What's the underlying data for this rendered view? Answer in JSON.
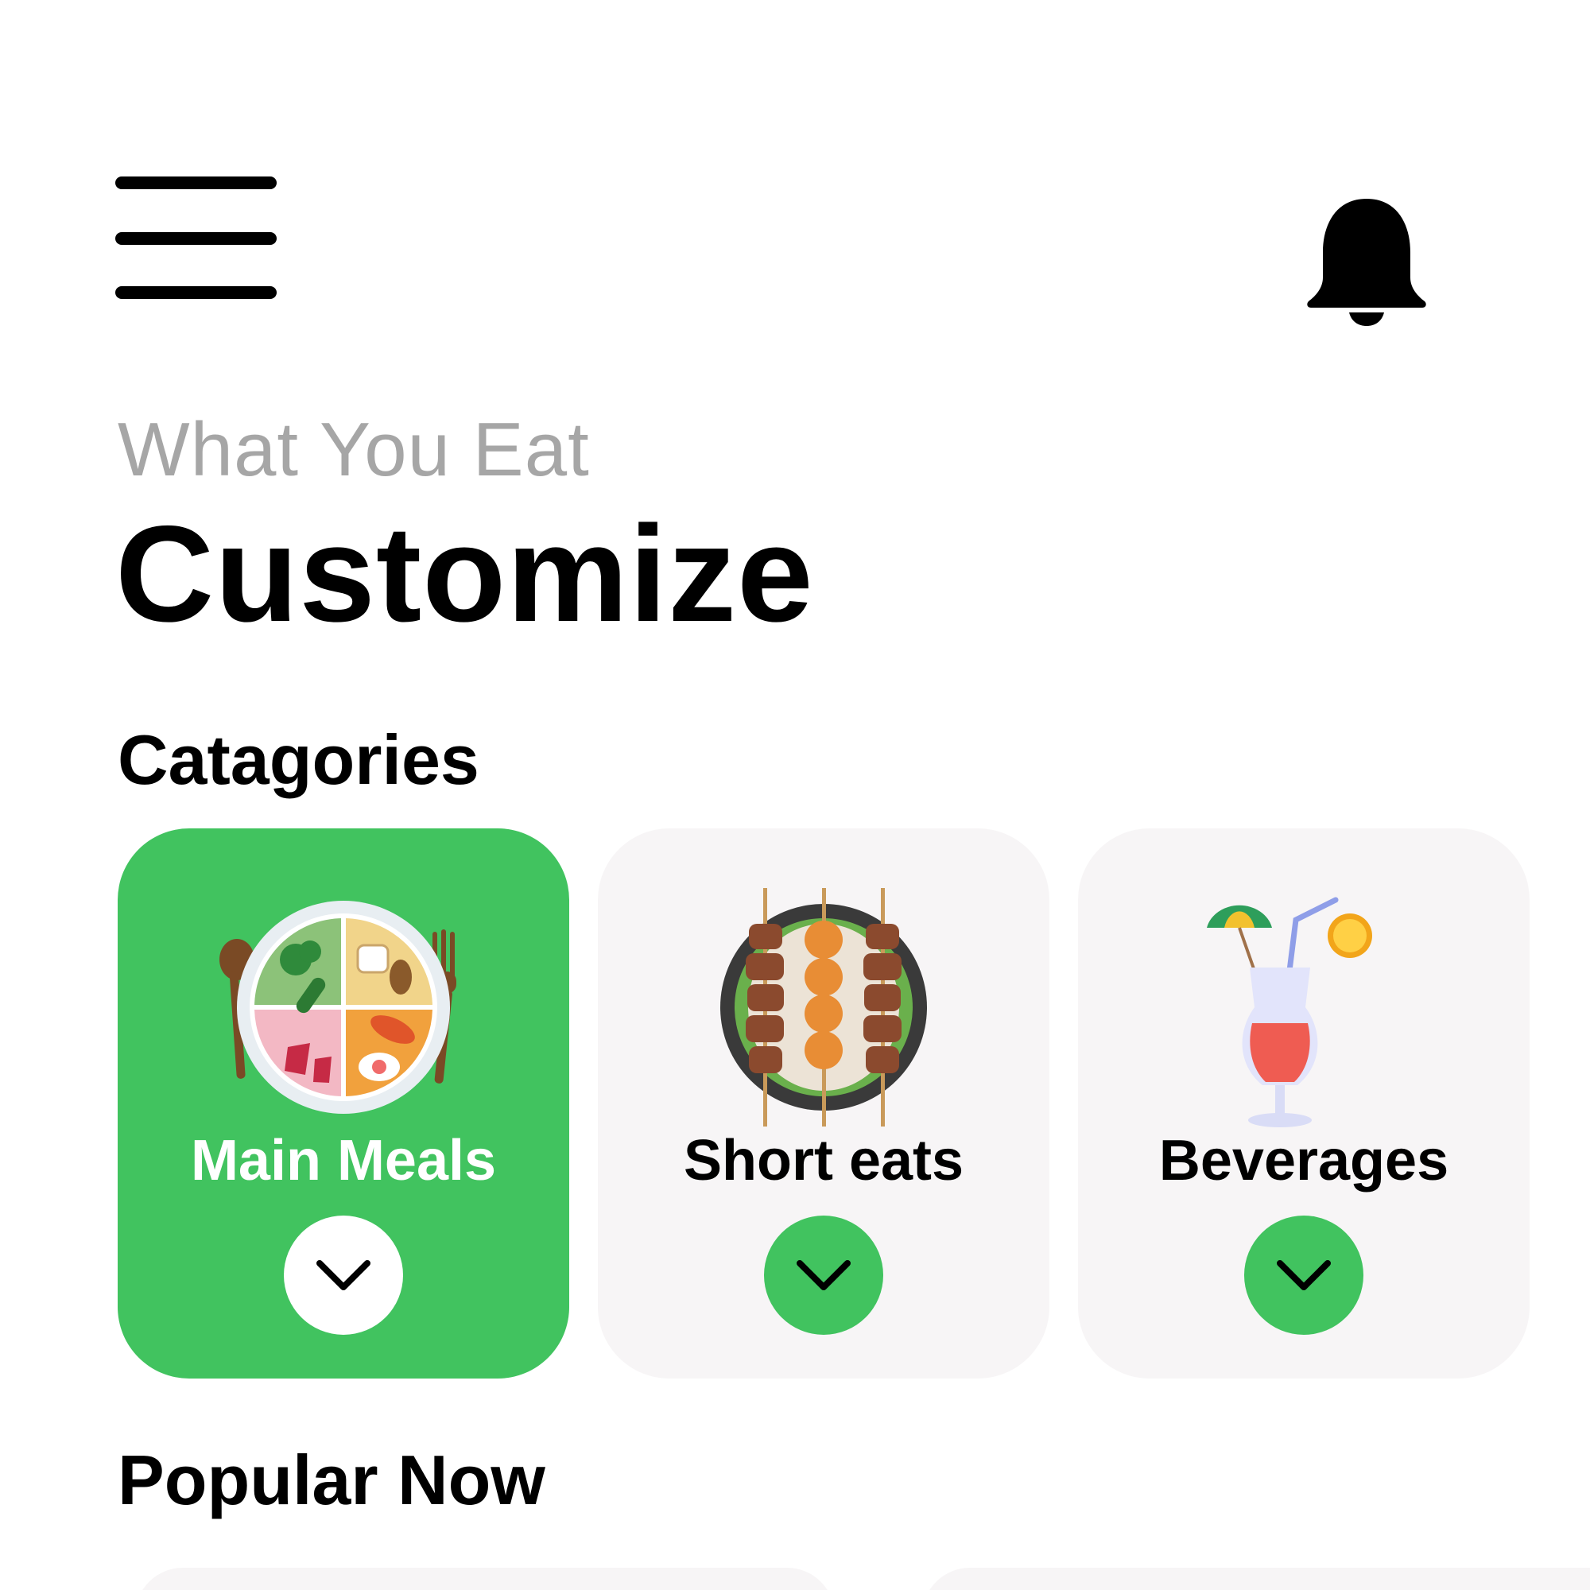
{
  "header": {
    "menu_icon": "hamburger-menu-icon",
    "notification_icon": "bell-icon"
  },
  "intro": {
    "subtitle": "What You Eat",
    "title": "Customize"
  },
  "categories": {
    "heading": "Catagories",
    "items": [
      {
        "label": "Main Meals",
        "icon": "meal-plate-icon",
        "selected": true
      },
      {
        "label": "Short eats",
        "icon": "skewers-icon",
        "selected": false
      },
      {
        "label": "Beverages",
        "icon": "cocktail-icon",
        "selected": false
      }
    ]
  },
  "popular": {
    "heading": "Popular Now"
  },
  "colors": {
    "accent": "#41c35f",
    "card_background": "#f7f5f6",
    "subtitle_text": "#a6a6a6"
  }
}
